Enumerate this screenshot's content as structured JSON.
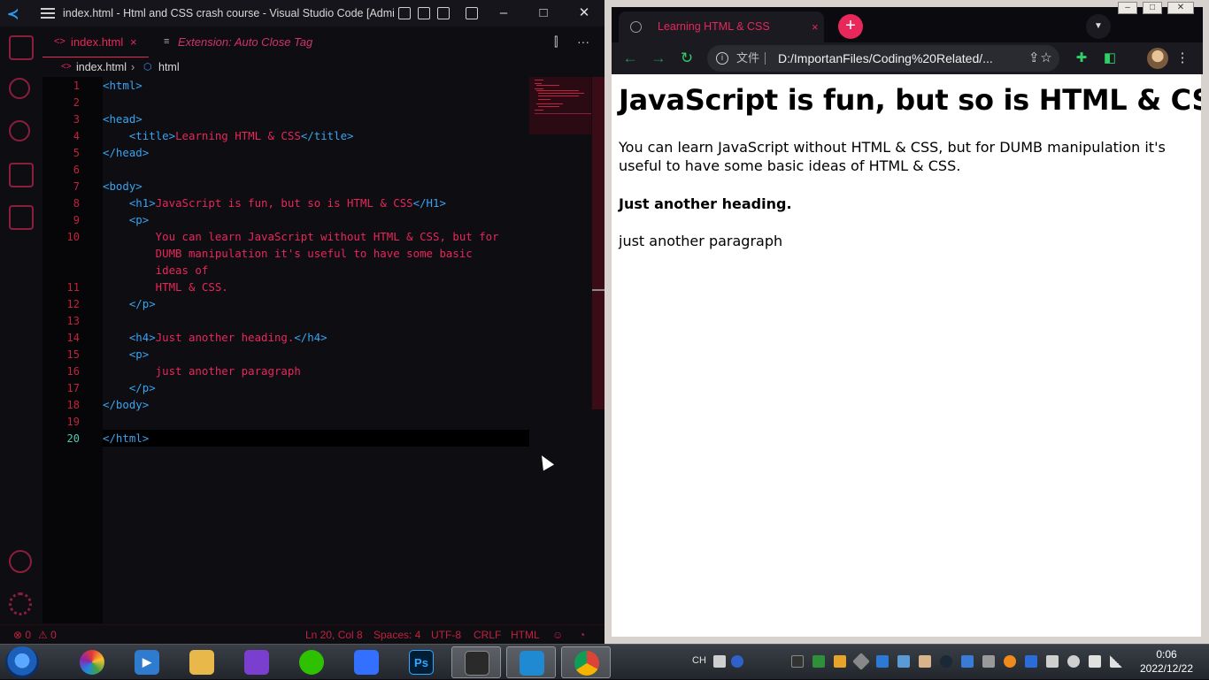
{
  "vscode": {
    "window_title": "index.html - Html and CSS crash course - Visual Studio Code [Admini...",
    "tabs": [
      {
        "label": "index.html",
        "close": "×"
      },
      {
        "label": "Extension: Auto Close Tag"
      }
    ],
    "tab_actions": {
      "split": "⫿",
      "more": "···"
    },
    "breadcrumb": {
      "file": "index.html",
      "separator": "›",
      "node": "html"
    },
    "line_numbers": [
      "1",
      "2",
      "3",
      "4",
      "5",
      "6",
      "7",
      "8",
      "9",
      "10",
      "",
      "",
      "11",
      "12",
      "13",
      "14",
      "15",
      "16",
      "17",
      "18",
      "19",
      "20"
    ],
    "active_line": "20",
    "code": {
      "l1_tag": "<html>",
      "l3_tag": "<head>",
      "l4_indent": "    ",
      "l4_open": "<title>",
      "l4_text": "Learning HTML & CSS",
      "l4_close": "</title>",
      "l5_tag": "</head>",
      "l7_tag": "<body>",
      "l8_indent": "    ",
      "l8_open": "<h1>",
      "l8_text": "JavaScript is fun, but so is HTML & CSS",
      "l8_close": "</H1>",
      "l9_indent": "    ",
      "l9_tag": "<p>",
      "l10a": "        You can learn JavaScript without HTML & CSS, but for",
      "l10b": "        DUMB manipulation it's useful to have some basic",
      "l10c": "        ideas of",
      "l11": "        HTML & CSS.",
      "l12_indent": "    ",
      "l12_tag": "</p>",
      "l14_indent": "    ",
      "l14_open": "<h4>",
      "l14_text": "Just another heading.",
      "l14_close": "</h4>",
      "l15_indent": "    ",
      "l15_tag": "<p>",
      "l16": "        just another paragraph",
      "l17_indent": "    ",
      "l17_tag": "</p>",
      "l18_tag": "</body>",
      "l20_tag": "</html>"
    },
    "status": {
      "errors": "⊗ 0",
      "warnings": "⚠ 0",
      "position": "Ln 20, Col 8",
      "spaces": "Spaces: 4",
      "encoding": "UTF-8",
      "eol": "CRLF",
      "language": "HTML"
    }
  },
  "chrome": {
    "tab_title": "Learning HTML & CSS",
    "tab_close": "×",
    "new_tab": "+",
    "scheme_label": "文件",
    "url": "D:/ImportanFiles/Coding%20Related/...",
    "window_controls": {
      "minimize": "–",
      "maximize": "□",
      "close": "✕"
    },
    "page": {
      "h1": "JavaScript is fun, but so is HTML & CSS",
      "p1": "You can learn JavaScript without HTML & CSS, but for DUMB manipulation it's useful to have some basic ideas of HTML & CSS.",
      "h4": "Just another heading.",
      "p2": "just another paragraph"
    }
  },
  "taskbar": {
    "apps": [
      {
        "name": "Pinwheel",
        "label": ""
      },
      {
        "name": "Video player",
        "label": "▶"
      },
      {
        "name": "File Explorer",
        "label": ""
      },
      {
        "name": "Visual Studio",
        "label": ""
      },
      {
        "name": "WeChat",
        "label": ""
      },
      {
        "name": "Feishu",
        "label": ""
      },
      {
        "name": "Photoshop",
        "label": "Ps"
      },
      {
        "name": "Terminal",
        "label": ""
      },
      {
        "name": "VS Code",
        "label": ""
      },
      {
        "name": "Chrome",
        "label": ""
      }
    ],
    "tray_language": "CH",
    "clock_time": "0:06",
    "clock_date": "2022/12/22"
  },
  "colors": {
    "accent": "#e8275a",
    "tag_blue": "#3ba3f0",
    "editor_bg": "#0d0d12",
    "page_bg": "#ffffff"
  }
}
